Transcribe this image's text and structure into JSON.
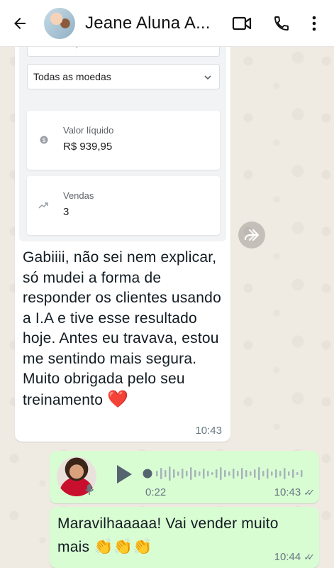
{
  "header": {
    "contact_name": "Jeane Aluna A...",
    "icons": [
      "back-arrow-icon",
      "video-call-icon",
      "phone-icon",
      "more-options-icon"
    ]
  },
  "screenshot": {
    "product_filter": "Todos os produtos",
    "currency_filter": "Todas as moedas",
    "net_value_label": "Valor líquido",
    "net_value": "R$ 939,95",
    "sales_label": "Vendas",
    "sales_count": "3"
  },
  "incoming": {
    "text": "Gabiiii, não sei nem explicar, só mudei a forma de responder os clientes usando a I.A e tive esse resultado hoje. Antes eu travava, estou me sentindo mais segura. Muito obrigada pelo seu treinamento",
    "emoji": "❤️",
    "time": "10:43"
  },
  "voice_note": {
    "duration": "0:22",
    "time": "10:43",
    "read_status": "✓✓"
  },
  "outgoing": {
    "text": "Maravilhaaaaa! Vai vender muito mais",
    "emoji": "👏👏👏",
    "time": "10:44",
    "read_status": "✓✓"
  },
  "colors": {
    "chat_background": "#efeae2",
    "outgoing_bubble": "#d9fdd3",
    "incoming_bubble": "#ffffff",
    "heart": "#e0245e"
  }
}
